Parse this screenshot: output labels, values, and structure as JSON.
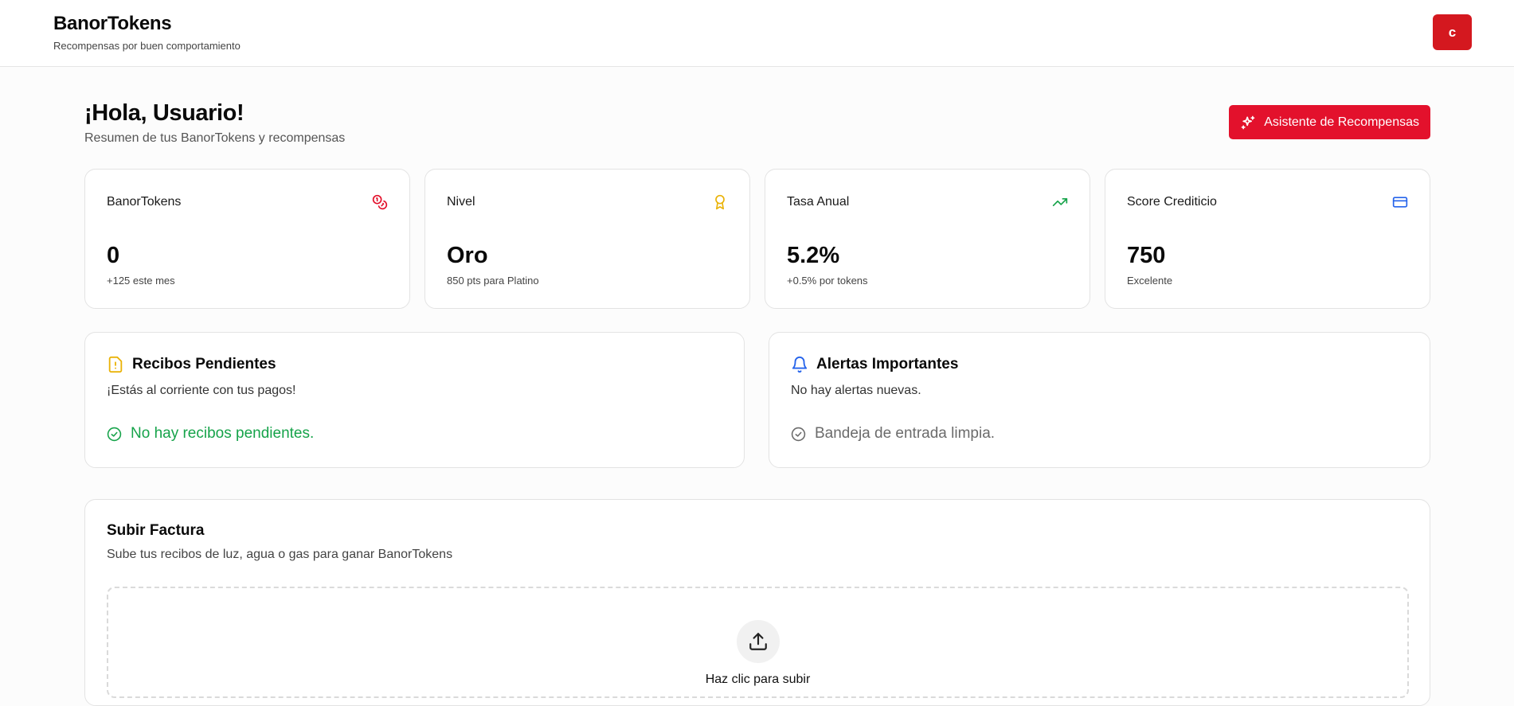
{
  "header": {
    "app_title": "BanorTokens",
    "app_subtitle": "Recompensas por buen comportamiento",
    "avatar_initial": "c"
  },
  "greeting": {
    "title": "¡Hola, Usuario!",
    "subtitle": "Resumen de tus BanorTokens y recompensas"
  },
  "assistant_button": {
    "label": "Asistente de Recompensas",
    "icon": "sparkles-icon"
  },
  "stats": [
    {
      "label": "BanorTokens",
      "value": "0",
      "sub": "+125 este mes",
      "icon": "coins-icon",
      "color": "#e3112c"
    },
    {
      "label": "Nivel",
      "value": "Oro",
      "sub": "850 pts para Platino",
      "icon": "award-icon",
      "color": "#eab308"
    },
    {
      "label": "Tasa Anual",
      "value": "5.2%",
      "sub": "+0.5% por tokens",
      "icon": "trending-up-icon",
      "color": "#16a34a"
    },
    {
      "label": "Score Crediticio",
      "value": "750",
      "sub": "Excelente",
      "icon": "credit-card-icon",
      "color": "#2563eb"
    }
  ],
  "receipts": {
    "title": "Recibos Pendientes",
    "description": "¡Estás al corriente con tus pagos!",
    "status": "No hay recibos pendientes.",
    "icon": "file-warning-icon",
    "color": "#eab308",
    "status_color": "#16a34a"
  },
  "alerts": {
    "title": "Alertas Importantes",
    "description": "No hay alertas nuevas.",
    "status": "Bandeja de entrada limpia.",
    "icon": "bell-icon",
    "color": "#2563eb",
    "status_color": "#6b6b6b"
  },
  "upload": {
    "title": "Subir Factura",
    "description": "Sube tus recibos de luz, agua o gas para ganar BanorTokens",
    "cta": "Haz clic para subir",
    "icon": "upload-icon"
  }
}
